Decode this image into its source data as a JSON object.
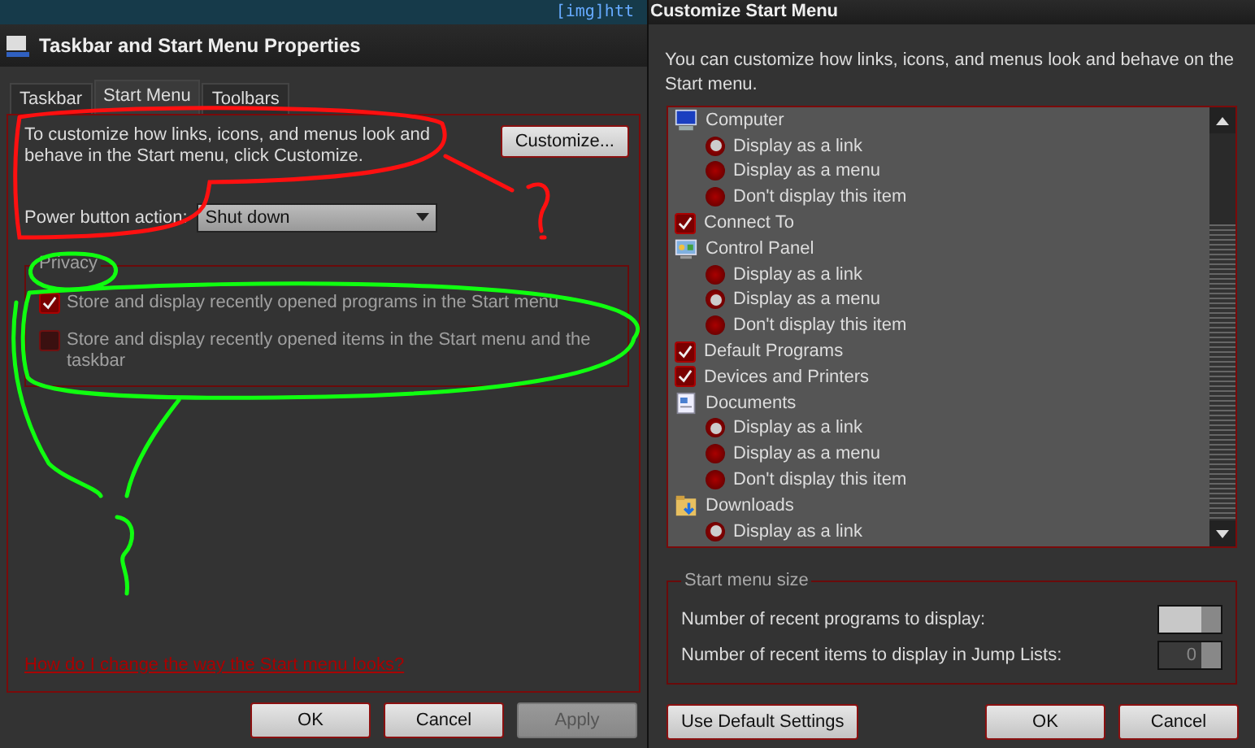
{
  "desktop": {
    "text": "[img]htt"
  },
  "properties_window": {
    "title": "Taskbar and Start Menu Properties",
    "tabs": [
      {
        "label": "Taskbar",
        "selected": false
      },
      {
        "label": "Start Menu",
        "selected": true
      },
      {
        "label": "Toolbars",
        "selected": false
      }
    ],
    "intro": "To customize how links, icons, and menus look and behave in the Start menu, click Customize.",
    "customize_button": "Customize...",
    "power_label": "Power button action:",
    "power_value": "Shut down",
    "privacy": {
      "title": "Privacy",
      "disabled": true,
      "options": [
        {
          "label": "Store and display recently opened programs in the Start menu",
          "checked": true
        },
        {
          "label": "Store and display recently opened items in the Start menu and the taskbar",
          "checked": false
        }
      ]
    },
    "help_link": "How do I change the way the Start menu looks?",
    "buttons": [
      {
        "label": "OK",
        "disabled": false
      },
      {
        "label": "Cancel",
        "disabled": false
      },
      {
        "label": "Apply",
        "disabled": true
      }
    ]
  },
  "customize_window": {
    "title": "Customize Start Menu",
    "intro": "You can customize how links, icons, and menus look and behave on the Start menu.",
    "items": [
      {
        "kind": "group",
        "label": "Computer"
      },
      {
        "kind": "radio",
        "label": "Display as a link",
        "selected": true
      },
      {
        "kind": "radio",
        "label": "Display as a menu",
        "selected": false
      },
      {
        "kind": "radio",
        "label": "Don't display this item",
        "selected": false
      },
      {
        "kind": "check",
        "label": "Connect To",
        "checked": true
      },
      {
        "kind": "group",
        "label": "Control Panel"
      },
      {
        "kind": "radio",
        "label": "Display as a link",
        "selected": false
      },
      {
        "kind": "radio",
        "label": "Display as a menu",
        "selected": true
      },
      {
        "kind": "radio",
        "label": "Don't display this item",
        "selected": false
      },
      {
        "kind": "check",
        "label": "Default Programs",
        "checked": true
      },
      {
        "kind": "check",
        "label": "Devices and Printers",
        "checked": true
      },
      {
        "kind": "group",
        "label": "Documents"
      },
      {
        "kind": "radio",
        "label": "Display as a link",
        "selected": true
      },
      {
        "kind": "radio",
        "label": "Display as a menu",
        "selected": false
      },
      {
        "kind": "radio",
        "label": "Don't display this item",
        "selected": false
      },
      {
        "kind": "group",
        "label": "Downloads"
      },
      {
        "kind": "radio",
        "label": "Display as a link",
        "selected": true
      }
    ],
    "size_group": {
      "title": "Start menu size",
      "rows": [
        {
          "label": "Number of recent programs to display:",
          "disabled": false
        },
        {
          "label": "Number of recent items to display in Jump Lists:",
          "value": "0",
          "disabled": true
        }
      ]
    },
    "default_button": "Use Default Settings",
    "buttons": [
      {
        "label": "OK",
        "disabled": false
      },
      {
        "label": "Cancel",
        "disabled": false
      }
    ]
  }
}
